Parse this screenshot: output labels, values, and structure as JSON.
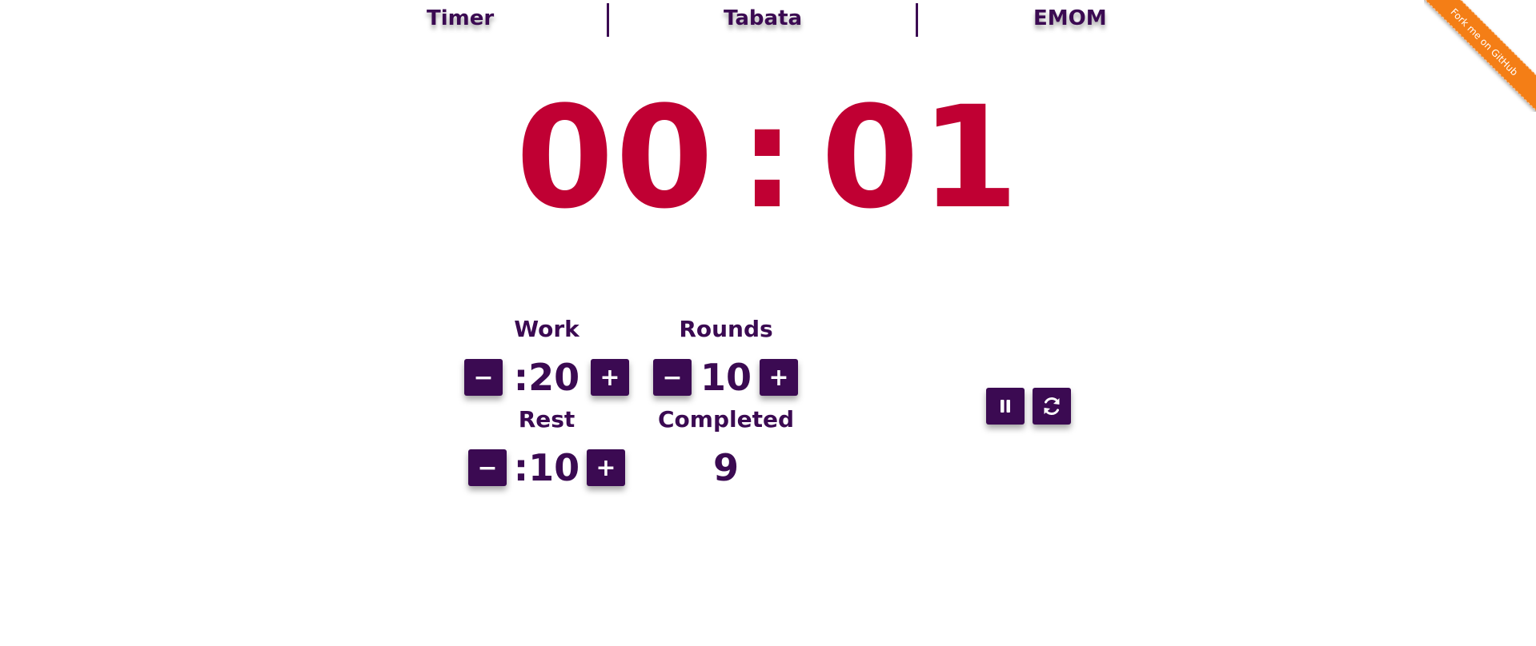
{
  "nav": {
    "items": [
      {
        "label": "Timer"
      },
      {
        "label": "Tabata"
      },
      {
        "label": "EMOM"
      }
    ]
  },
  "ribbon": {
    "label": "Fork me on GitHub",
    "color": "#f47e16"
  },
  "clock": {
    "minutes": "00",
    "separator": ":",
    "seconds": "01",
    "color": "#c00033"
  },
  "controls": {
    "work": {
      "label": "Work",
      "value": ":20"
    },
    "rounds": {
      "label": "Rounds",
      "value": "10"
    },
    "rest": {
      "label": "Rest",
      "value": ":10"
    },
    "completed": {
      "label": "Completed",
      "value": "9"
    },
    "decrement_symbol": "−",
    "increment_symbol": "+"
  },
  "actions": {
    "pause_icon": "pause-icon",
    "reset_icon": "refresh-icon"
  },
  "colors": {
    "primary": "#3b0a52",
    "accent": "#c00033",
    "ribbon": "#f47e16"
  }
}
